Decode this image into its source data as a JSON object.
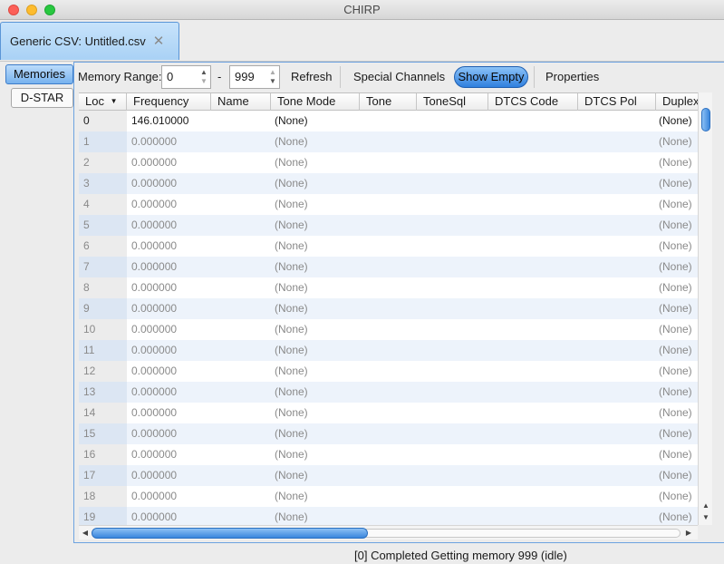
{
  "window": {
    "title": "CHIRP"
  },
  "doc_tab": {
    "label": "Generic CSV: Untitled.csv"
  },
  "side_tabs": [
    {
      "label": "Memories"
    },
    {
      "label": "D-STAR"
    }
  ],
  "toolbar": {
    "memory_range_label": "Memory Range:",
    "range_start": "0",
    "range_dash": "-",
    "range_end": "999",
    "refresh_label": "Refresh",
    "special_channels_label": "Special Channels",
    "show_empty_label": "Show Empty",
    "properties_label": "Properties"
  },
  "table": {
    "columns": [
      "Loc",
      "Frequency",
      "Name",
      "Tone Mode",
      "Tone",
      "ToneSql",
      "DTCS Code",
      "DTCS Pol",
      "Duplex"
    ],
    "sort_indicator": "▼",
    "rows": [
      {
        "loc": "0",
        "frequency": "146.010000",
        "tone_mode": "(None)",
        "duplex": "(None)"
      },
      {
        "loc": "1",
        "frequency": "0.000000",
        "tone_mode": "(None)",
        "duplex": "(None)"
      },
      {
        "loc": "2",
        "frequency": "0.000000",
        "tone_mode": "(None)",
        "duplex": "(None)"
      },
      {
        "loc": "3",
        "frequency": "0.000000",
        "tone_mode": "(None)",
        "duplex": "(None)"
      },
      {
        "loc": "4",
        "frequency": "0.000000",
        "tone_mode": "(None)",
        "duplex": "(None)"
      },
      {
        "loc": "5",
        "frequency": "0.000000",
        "tone_mode": "(None)",
        "duplex": "(None)"
      },
      {
        "loc": "6",
        "frequency": "0.000000",
        "tone_mode": "(None)",
        "duplex": "(None)"
      },
      {
        "loc": "7",
        "frequency": "0.000000",
        "tone_mode": "(None)",
        "duplex": "(None)"
      },
      {
        "loc": "8",
        "frequency": "0.000000",
        "tone_mode": "(None)",
        "duplex": "(None)"
      },
      {
        "loc": "9",
        "frequency": "0.000000",
        "tone_mode": "(None)",
        "duplex": "(None)"
      },
      {
        "loc": "10",
        "frequency": "0.000000",
        "tone_mode": "(None)",
        "duplex": "(None)"
      },
      {
        "loc": "11",
        "frequency": "0.000000",
        "tone_mode": "(None)",
        "duplex": "(None)"
      },
      {
        "loc": "12",
        "frequency": "0.000000",
        "tone_mode": "(None)",
        "duplex": "(None)"
      },
      {
        "loc": "13",
        "frequency": "0.000000",
        "tone_mode": "(None)",
        "duplex": "(None)"
      },
      {
        "loc": "14",
        "frequency": "0.000000",
        "tone_mode": "(None)",
        "duplex": "(None)"
      },
      {
        "loc": "15",
        "frequency": "0.000000",
        "tone_mode": "(None)",
        "duplex": "(None)"
      },
      {
        "loc": "16",
        "frequency": "0.000000",
        "tone_mode": "(None)",
        "duplex": "(None)"
      },
      {
        "loc": "17",
        "frequency": "0.000000",
        "tone_mode": "(None)",
        "duplex": "(None)"
      },
      {
        "loc": "18",
        "frequency": "0.000000",
        "tone_mode": "(None)",
        "duplex": "(None)"
      },
      {
        "loc": "19",
        "frequency": "0.000000",
        "tone_mode": "(None)",
        "duplex": "(None)"
      }
    ]
  },
  "status": {
    "text": "[0] Completed Getting memory 999 (idle)"
  },
  "icons": {
    "close_tab": "close-x-icon",
    "sort": "sort-desc-icon",
    "spin_up": "spin-up-icon",
    "spin_down": "spin-down-icon"
  },
  "colors": {
    "accent": "#3a86dd",
    "alt_row": "#edf3fb",
    "dim_text": "#8a8a8a"
  }
}
